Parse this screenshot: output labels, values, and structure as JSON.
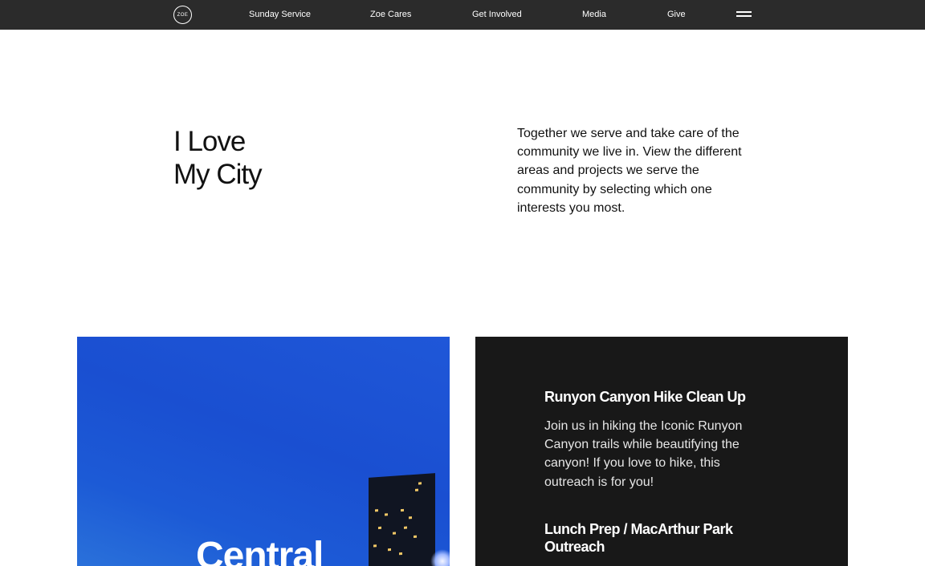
{
  "nav": {
    "logo_text": "ZOE",
    "links": [
      "Sunday Service",
      "Zoe Cares",
      "Get Involved",
      "Media",
      "Give"
    ],
    "menu_icon": "hamburger-icon"
  },
  "hero": {
    "title_line1": "I Love",
    "title_line2": "My City",
    "description": "Together we serve and take care of the community we live in. View the different areas and projects we serve the community by selecting which one interests you most."
  },
  "image_card": {
    "title": "Central"
  },
  "outreach": [
    {
      "title": "Runyon Canyon Hike Clean Up",
      "description": "Join us in hiking the Iconic Runyon Canyon trails while beautifying the canyon! If you love to hike, this outreach is for you!"
    },
    {
      "title": "Lunch Prep / MacArthur Park Outreach",
      "description": ""
    }
  ],
  "colors": {
    "nav_bg": "#2b2b2b",
    "panel_bg": "#181818",
    "sky_blue": "#1a4fd1"
  }
}
